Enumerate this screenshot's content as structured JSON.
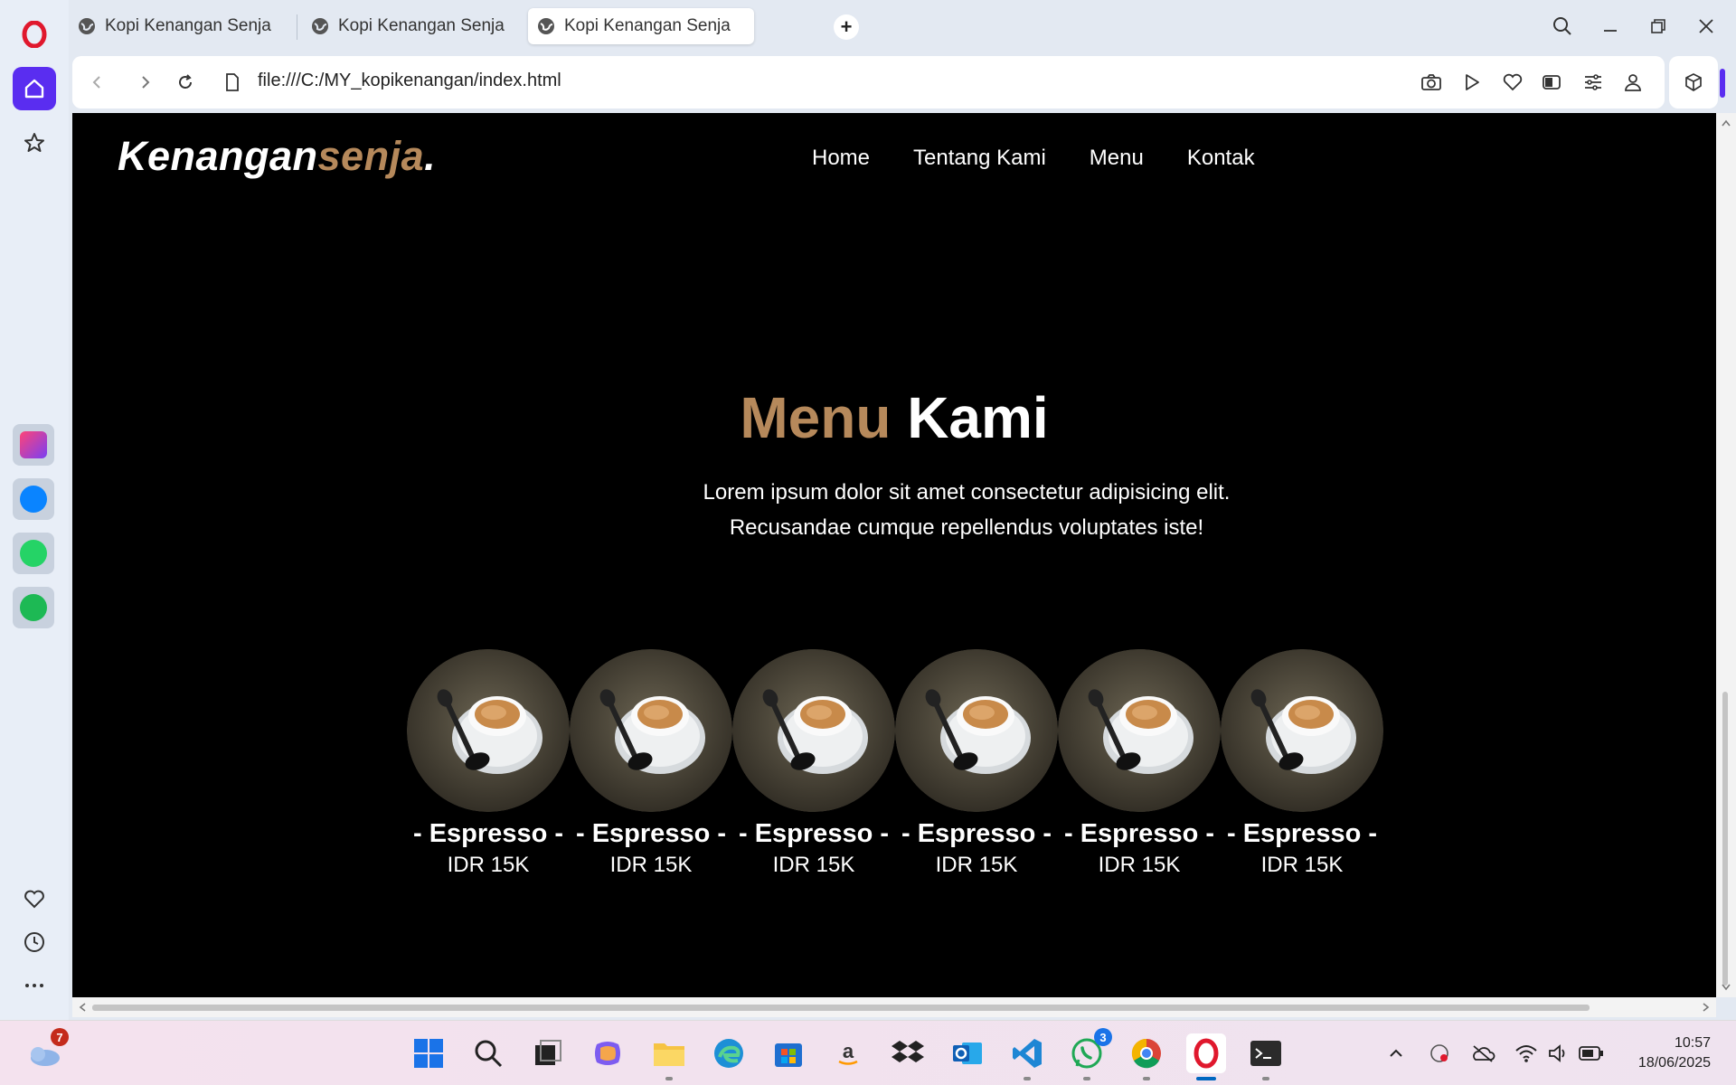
{
  "browser": {
    "tabs": [
      {
        "title": "Kopi Kenangan Senja"
      },
      {
        "title": "Kopi Kenangan Senja"
      },
      {
        "title": "Kopi Kenangan Senja"
      }
    ],
    "new_tab_label": "+",
    "url": "file:///C:/MY_kopikenangan/index.html"
  },
  "page": {
    "brand_main": "Kenangan",
    "brand_accent": "senja",
    "brand_dot": ".",
    "nav": [
      {
        "label": "Home"
      },
      {
        "label": "Tentang Kami"
      },
      {
        "label": "Menu"
      },
      {
        "label": "Kontak"
      }
    ],
    "hero_accent": "Menu",
    "hero_main": "Kami",
    "hero_subtitle_line1": "Lorem ipsum dolor sit amet consectetur adipisicing elit.",
    "hero_subtitle_line2": "Recusandae cumque repellendus voluptates iste!",
    "menu_items": [
      {
        "name": "- Espresso -",
        "price": "IDR 15K"
      },
      {
        "name": "- Espresso -",
        "price": "IDR 15K"
      },
      {
        "name": "- Espresso -",
        "price": "IDR 15K"
      },
      {
        "name": "- Espresso -",
        "price": "IDR 15K"
      },
      {
        "name": "- Espresso -",
        "price": "IDR 15K"
      },
      {
        "name": "- Espresso -",
        "price": "IDR 15K"
      }
    ],
    "accent_color": "#b6895b"
  },
  "taskbar": {
    "weather_badge": "7",
    "whatsapp_badge": "3",
    "time": "10:57",
    "date": "18/06/2025"
  }
}
